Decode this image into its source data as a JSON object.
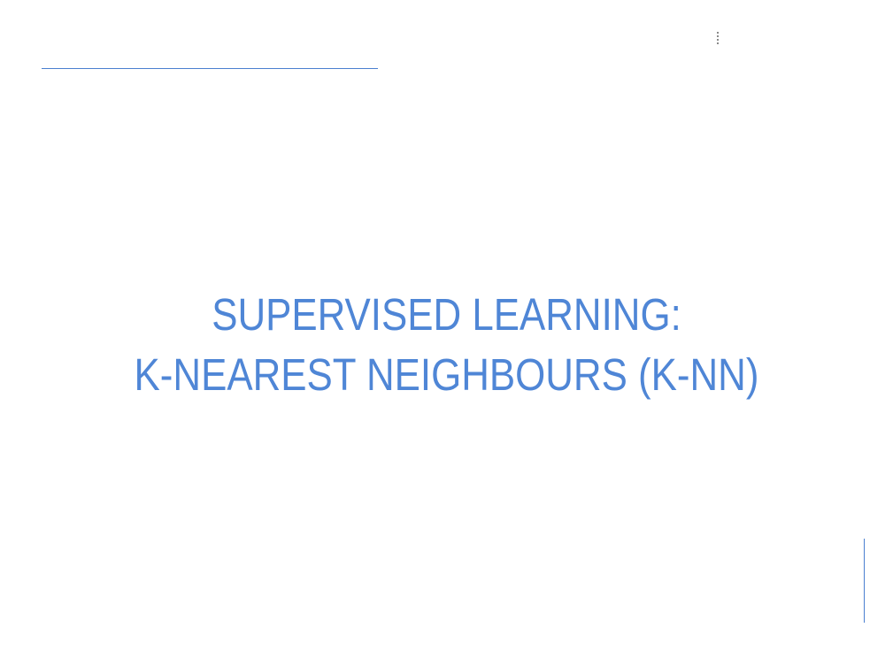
{
  "slide": {
    "title_line_1": "SUPERVISED LEARNING:",
    "title_line_2": "K-NEAREST NEIGHBOURS (K-NN)"
  },
  "colors": {
    "title": "#4f86d6",
    "rule": "#4a7fd0",
    "background": "#ffffff"
  }
}
